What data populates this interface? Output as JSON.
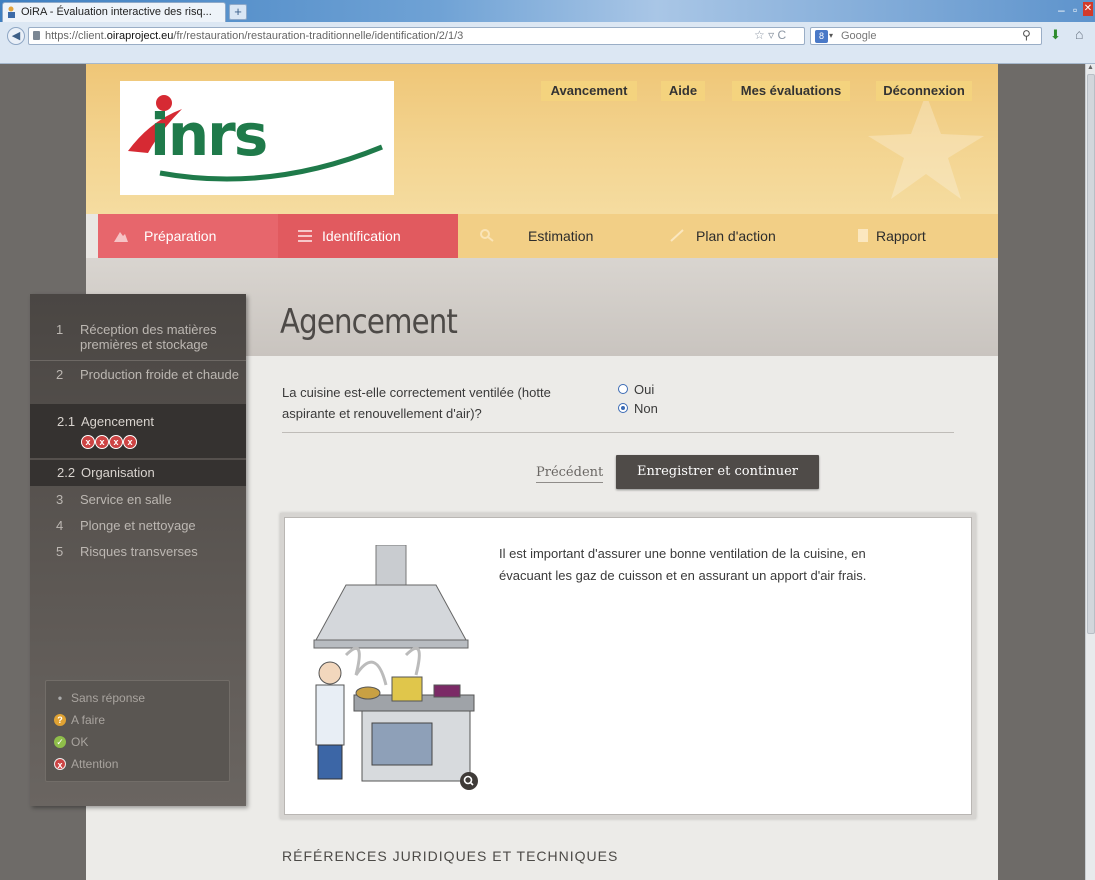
{
  "browser": {
    "tab_title": "OiRA - Évaluation interactive des risq...",
    "new_tab": "+",
    "url_prefix": "https://client.",
    "url_host": "oiraproject.eu",
    "url_path": "/fr/restauration/restauration-traditionnelle/identification/2/1/3",
    "search_engine": "Google"
  },
  "header": {
    "logo_text": "inrs",
    "menu": [
      "Avancement",
      "Aide",
      "Mes évaluations",
      "Déconnexion"
    ]
  },
  "steps": [
    {
      "label": "Préparation",
      "icon": "mountain-icon"
    },
    {
      "label": "Identification",
      "icon": "checklist-icon"
    },
    {
      "label": "Estimation",
      "icon": "magnifier-icon"
    },
    {
      "label": "Plan d'action",
      "icon": "pencil-icon"
    },
    {
      "label": "Rapport",
      "icon": "document-icon"
    }
  ],
  "sidebar": {
    "items": [
      {
        "num": "1",
        "label": "Réception des matières premières et stockage"
      },
      {
        "num": "2",
        "label": "Production froide et chaude"
      },
      {
        "num": "2.1",
        "label": "Agencement"
      },
      {
        "num": "2.2",
        "label": "Organisation"
      },
      {
        "num": "3",
        "label": "Service en salle"
      },
      {
        "num": "4",
        "label": "Plonge et nettoyage"
      },
      {
        "num": "5",
        "label": "Risques transverses"
      }
    ],
    "legend": [
      {
        "label": "Sans réponse",
        "icon": "bullet-icon"
      },
      {
        "label": "A faire",
        "icon": "question-icon"
      },
      {
        "label": "OK",
        "icon": "check-icon"
      },
      {
        "label": "Attention",
        "icon": "cross-icon"
      }
    ]
  },
  "main": {
    "title": "Agencement",
    "question": "La cuisine est-elle correctement ventilée (hotte aspirante et renouvellement d'air)?",
    "options": [
      {
        "label": "Oui",
        "selected": false
      },
      {
        "label": "Non",
        "selected": true
      }
    ],
    "prev_label": "Précédent",
    "save_label": "Enregistrer et continuer",
    "info_text": "Il est important d'assurer une bonne ventilation de la cuisine, en évacuant les gaz de cuisson et en assurant un apport d'air frais.",
    "refs_heading": "RÉFÉRENCES JURIDIQUES ET TECHNIQUES"
  },
  "colors": {
    "header_bg": "#efc677",
    "active_step": "#e15a5f",
    "sidebar_bg": "#4a4643",
    "save_button": "#4f4b48"
  }
}
